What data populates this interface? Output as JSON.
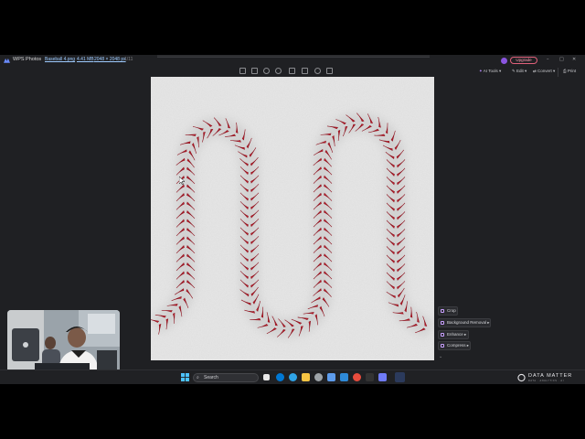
{
  "app": {
    "name": "WPS Photos",
    "file_name": "Baseball 4.png",
    "file_size": "4.41 MB",
    "file_dims": "2048 × 2048 px",
    "file_index": "1/11"
  },
  "header": {
    "upgrade_label": "Upgrade",
    "min_glyph": "–",
    "max_glyph": "□",
    "close_glyph": "✕"
  },
  "right_toolbar": {
    "ai_tools": "AI Tools ▾",
    "edit": "Edit ▾",
    "convert": "Convert ▾",
    "print": "Print"
  },
  "image_toolbar": {
    "icons": [
      "fit-icon",
      "actual-size-icon",
      "zoom-in-icon",
      "zoom-out-icon",
      "rotate-icon",
      "crop-icon",
      "favorite-icon",
      "delete-icon"
    ]
  },
  "ai_menu": {
    "items": [
      {
        "label": "Crop"
      },
      {
        "label": "Background Removal ▸"
      },
      {
        "label": "Enhance ▸"
      },
      {
        "label": "Compress ▸"
      }
    ],
    "collapse_glyph": "⌄"
  },
  "taskbar": {
    "search_placeholder": "Search",
    "search_glyph": "⌕",
    "brand": "DATA MATTER",
    "brand_sub": "DATA · ANALYTICS · AI"
  },
  "colors": {
    "stitch_red": "#c41e2c",
    "leather": "#e9e9e9",
    "accent_purple": "#8a55e0"
  }
}
